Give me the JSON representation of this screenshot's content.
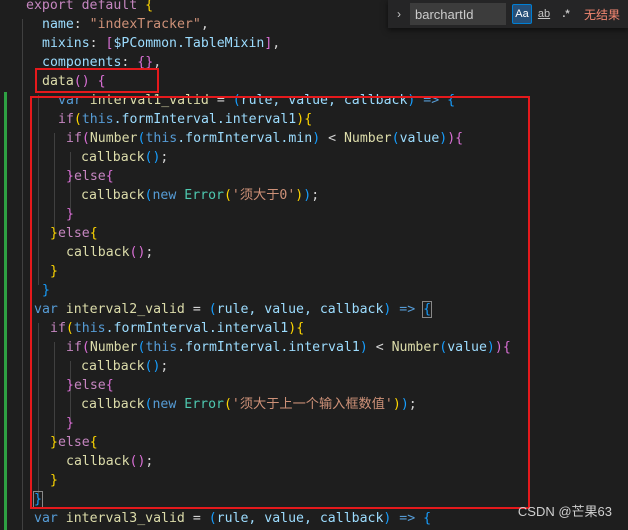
{
  "code": {
    "l1_a": "export",
    "l1_b": " ",
    "l1_c": "default",
    "l1_d": " ",
    "l1_e": "{",
    "l2_key": "name",
    "l2_colon": ": ",
    "l2_val": "\"indexTracker\"",
    "l2_end": ",",
    "l3_key": "mixins",
    "l3_colon": ": ",
    "l3_open": "[",
    "l3_val": "$PCommon.TableMixin",
    "l3_close": "]",
    "l3_end": ",",
    "l4_key": "components",
    "l4_colon": ": ",
    "l4_val": "{}",
    "l4_end": ",",
    "l5_fn": "data",
    "l5_paren": "()",
    "l5_sp": " ",
    "l5_brace": "{",
    "l6_var": "var",
    "l6_name": " interval1_valid",
    "l6_eq": " = ",
    "l6_open": "(",
    "l6_args": "rule, value, callback",
    "l6_close": ")",
    "l6_arrow": " => ",
    "l6_brace": "{",
    "l7_if": "if",
    "l7_open": "(",
    "l7_this": "this",
    "l7_prop": ".formInterval.interval1",
    "l7_close": ")",
    "l7_brace": "{",
    "l8_if": "if",
    "l8_open": "(",
    "l8_fn": "Number",
    "l8_o2": "(",
    "l8_this": "this",
    "l8_prop": ".formInterval.min",
    "l8_c2": ")",
    "l8_lt": " < ",
    "l8_fn2": "Number",
    "l8_o3": "(",
    "l8_arg": "value",
    "l8_c3": ")",
    "l8_close": ")",
    "l8_brace": "{",
    "l9_fn": "callback",
    "l9_paren": "()",
    "l9_end": ";",
    "l10_close": "}",
    "l10_else": "else",
    "l10_brace": "{",
    "l11_fn": "callback",
    "l11_open": "(",
    "l11_new": "new",
    "l11_err": " Error",
    "l11_o2": "(",
    "l11_str": "'须大于0'",
    "l11_c2": ")",
    "l11_close": ")",
    "l11_end": ";",
    "l12_close": "}",
    "l13_close": "}",
    "l13_else": "else",
    "l13_brace": "{",
    "l14_fn": "callback",
    "l14_paren": "()",
    "l14_end": ";",
    "l15_close": "}",
    "l16_close": "}",
    "l17_var": "var",
    "l17_name": " interval2_valid",
    "l17_eq": " = ",
    "l17_open": "(",
    "l17_args": "rule, value, callback",
    "l17_close": ")",
    "l17_arrow": " => ",
    "l17_brace": "{",
    "l18_if": "if",
    "l18_open": "(",
    "l18_this": "this",
    "l18_prop": ".formInterval.interval1",
    "l18_close": ")",
    "l18_brace": "{",
    "l19_if": "if",
    "l19_open": "(",
    "l19_fn": "Number",
    "l19_o2": "(",
    "l19_this": "this",
    "l19_prop": ".formInterval.interval1",
    "l19_c2": ")",
    "l19_lt": " < ",
    "l19_fn2": "Number",
    "l19_o3": "(",
    "l19_arg": "value",
    "l19_c3": ")",
    "l19_close": ")",
    "l19_brace": "{",
    "l20_fn": "callback",
    "l20_paren": "()",
    "l20_end": ";",
    "l21_close": "}",
    "l21_else": "else",
    "l21_brace": "{",
    "l22_fn": "callback",
    "l22_open": "(",
    "l22_new": "new",
    "l22_err": " Error",
    "l22_o2": "(",
    "l22_str": "'须大于上一个输入框数值'",
    "l22_c2": ")",
    "l22_close": ")",
    "l22_end": ";",
    "l23_close": "}",
    "l24_close": "}",
    "l24_else": "else",
    "l24_brace": "{",
    "l25_fn": "callback",
    "l25_paren": "()",
    "l25_end": ";",
    "l26_close": "}",
    "l27_close": "}",
    "l28_var": "var",
    "l28_name": " interval3_valid",
    "l28_eq": " = ",
    "l28_open": "(",
    "l28_args": "rule, value, callback",
    "l28_close": ")",
    "l28_arrow": " => ",
    "l28_brace": "{"
  },
  "find_widget": {
    "toggle_icon": "›",
    "query": "barchartId",
    "match_case": "Aa",
    "whole_word": "ab",
    "regex": ".*",
    "result": "无结果"
  },
  "watermark": "CSDN @芒果63",
  "colors": {
    "background": "#1e1e1e",
    "highlight_box": "#e5191c",
    "keyword": "#569cd6",
    "control": "#c586c0",
    "string": "#ce9178",
    "function": "#dcdcaa",
    "variable": "#9cdcfe",
    "class": "#4ec9b0"
  }
}
